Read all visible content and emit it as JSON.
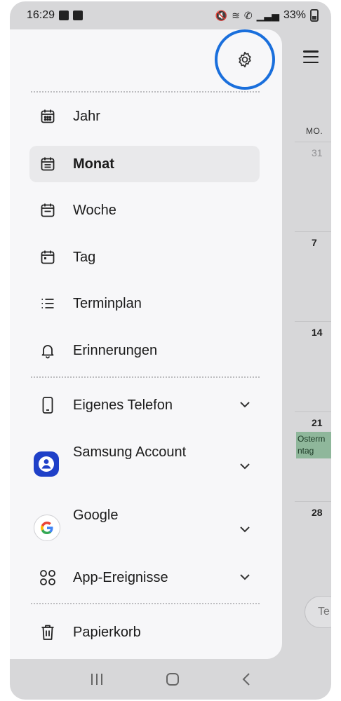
{
  "status_bar": {
    "time": "16:29",
    "battery": "33%"
  },
  "calendar_background": {
    "weekday": "MO.",
    "days": [
      "31",
      "7",
      "14",
      "21",
      "28"
    ],
    "event": "Ostermontag",
    "event_visible": "Osterm ntag",
    "fab_text": "Te"
  },
  "drawer": {
    "views": [
      {
        "label": "Jahr",
        "icon": "calendar-year-icon",
        "active": false
      },
      {
        "label": "Monat",
        "icon": "calendar-month-icon",
        "active": true
      },
      {
        "label": "Woche",
        "icon": "calendar-week-icon",
        "active": false
      },
      {
        "label": "Tag",
        "icon": "calendar-day-icon",
        "active": false
      },
      {
        "label": "Terminplan",
        "icon": "list-icon",
        "active": false
      },
      {
        "label": "Erinnerungen",
        "icon": "bell-icon",
        "active": false
      }
    ],
    "accounts": [
      {
        "label": "Eigenes Telefon",
        "icon": "phone-icon"
      },
      {
        "label": "Samsung Account",
        "icon": "samsung-account-icon"
      },
      {
        "label": "Google",
        "icon": "google-icon"
      },
      {
        "label": "App-Ereignisse",
        "icon": "apps-grid-icon"
      }
    ],
    "trash": {
      "label": "Papierkorb",
      "icon": "trash-icon"
    }
  },
  "colors": {
    "highlight_ring": "#1a6fdc",
    "drawer_bg": "#f7f7f9",
    "active_item_bg": "#e9e9eb",
    "samsung_blue": "#1f40c8",
    "event_green": "#8fb79b"
  }
}
